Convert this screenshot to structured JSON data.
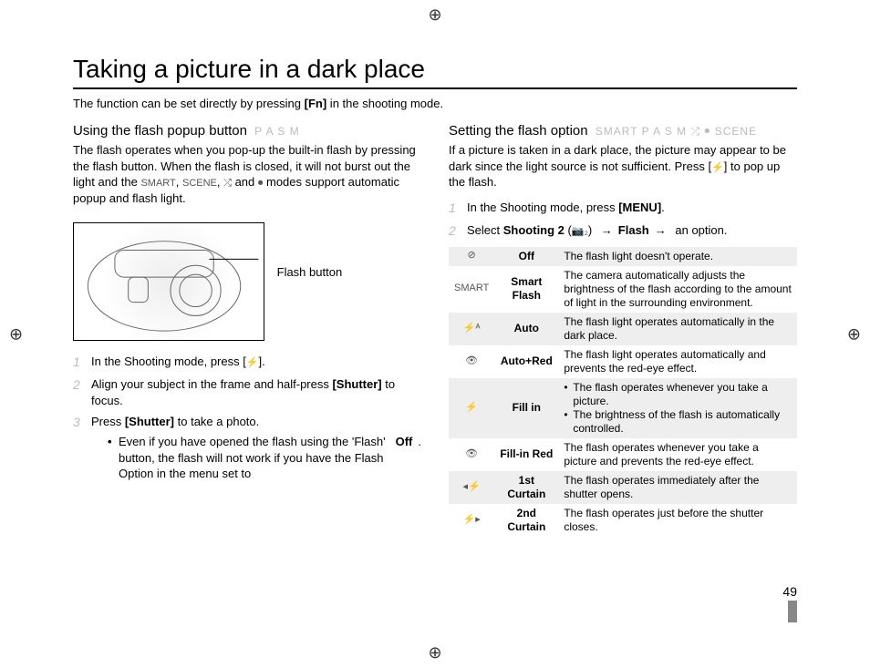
{
  "page_number": "49",
  "title": "Taking a picture in a dark place",
  "intro_pre": "The function can be set directly by pressing ",
  "intro_bold": "[Fn]",
  "intro_post": " in the shooting mode.",
  "left": {
    "heading": "Using the flash popup button",
    "heading_modes": "P A S M",
    "body_a": "The flash operates when you pop-up the built-in flash by pressing the flash button. When the flash is closed, it will not burst out the light and the ",
    "body_b": ", ",
    "body_c": " and ",
    "body_d": " modes support automatic popup and flash light.",
    "mode_smart": "SMART",
    "mode_scene": "SCENE",
    "mode_dual": "⤮",
    "mode_video": "⏺",
    "diagram_label": "Flash button",
    "steps": [
      {
        "num": "1",
        "pre": "In the Shooting mode, press [",
        "icon": "⚡",
        "post": "]."
      },
      {
        "num": "2",
        "pre": "Align your subject in the frame and half-press ",
        "bold": "[Shutter]",
        "post": " to focus."
      },
      {
        "num": "3",
        "pre": "Press ",
        "bold": "[Shutter]",
        "post": " to take a photo."
      }
    ],
    "note": {
      "pre": "Even if you have opened the flash using the 'Flash' button, the flash will not work if you have the Flash Option in the menu set to ",
      "bold": "Off",
      "post": "."
    }
  },
  "right": {
    "heading": "Setting the flash option",
    "heading_modes": "SMART  P A S M  ⤮  ⏺  SCENE",
    "body_a": "If a picture is taken in a dark place, the picture may appear to be dark since the light source is not sufficient. Press [",
    "body_icon": "⚡",
    "body_b": "] to pop up the flash.",
    "steps": [
      {
        "num": "1",
        "pre": "In the Shooting mode, press ",
        "bold": "[MENU]",
        "post": "."
      },
      {
        "num": "2",
        "pre": "Select ",
        "bold1": "Shooting 2",
        "paren_pre": " (",
        "paren_icon": "📷₂",
        "paren_post": ") ",
        "arrow": "→",
        "bold2": "Flash",
        "arrow2": "→",
        "tail": " an option."
      }
    ],
    "table": [
      {
        "icon": "⊘",
        "name": "Off",
        "desc": "The flash light doesn't operate."
      },
      {
        "icon": "SMART",
        "name": "Smart Flash",
        "desc": "The camera automatically adjusts the brightness of the flash according to the amount of light in the surrounding environment."
      },
      {
        "icon": "⚡ᴬ",
        "name": "Auto",
        "desc": "The flash light operates automatically in the dark place."
      },
      {
        "icon": "👁",
        "name": "Auto+Red",
        "desc": "The flash light operates automatically and prevents the red-eye effect."
      },
      {
        "icon": "⚡",
        "name": "Fill in",
        "desc_list": [
          "The flash operates whenever you take a picture.",
          "The brightness of the flash is automatically controlled."
        ]
      },
      {
        "icon": "👁",
        "name": "Fill-in Red",
        "desc": "The flash operates whenever you take a picture and prevents the red-eye effect."
      },
      {
        "icon": "◂⚡",
        "name": "1st Curtain",
        "desc": "The flash operates immediately after the shutter opens."
      },
      {
        "icon": "⚡▸",
        "name": "2nd Curtain",
        "desc": "The flash operates just before the shutter closes."
      }
    ]
  }
}
